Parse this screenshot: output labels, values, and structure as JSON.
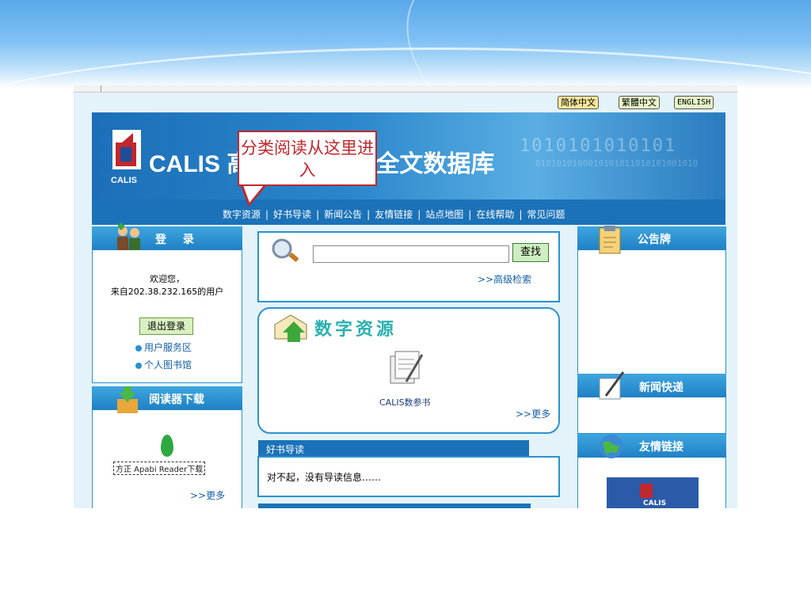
{
  "languages": [
    "简体中文",
    "繁體中文",
    "ENGLISH"
  ],
  "header": {
    "logo_caption": "CALIS",
    "title_left": "CALIS 高",
    "title_right": "书全文数据库",
    "binary": "1010101010101",
    "binary_small": "0101010100010101011010101001010"
  },
  "callout": {
    "text": "分类阅读从这里进入"
  },
  "nav": [
    "数字资源",
    "好书导读",
    "新闻公告",
    "友情链接",
    "站点地图",
    "在线帮助",
    "常见问题"
  ],
  "nav_separator": "|",
  "login": {
    "title": "登 录",
    "welcome": "欢迎您，",
    "from": "来自202.38.232.165的用户",
    "logout": "退出登录",
    "links": [
      "用户服务区",
      "个人图书馆"
    ]
  },
  "reader": {
    "title": "阅读器下载",
    "apabi_label": "方正 Apabi Reader下载",
    "more": ">>更多"
  },
  "search": {
    "button": "查找",
    "advanced": ">>高级检索"
  },
  "resources": {
    "title": "数字资源",
    "item": "CALIS数参书",
    "more": ">>更多"
  },
  "good_books": {
    "title": "好书导读",
    "empty_text": "对不起，没有导读信息……"
  },
  "notice": {
    "title": "公告牌"
  },
  "news": {
    "title": "新闻快递"
  },
  "links": {
    "title": "友情链接",
    "logo_text": "CALIS"
  },
  "colors": {
    "accent": "#1b72b8",
    "callout": "#c0282d",
    "resource_title": "#2ab0b0"
  }
}
